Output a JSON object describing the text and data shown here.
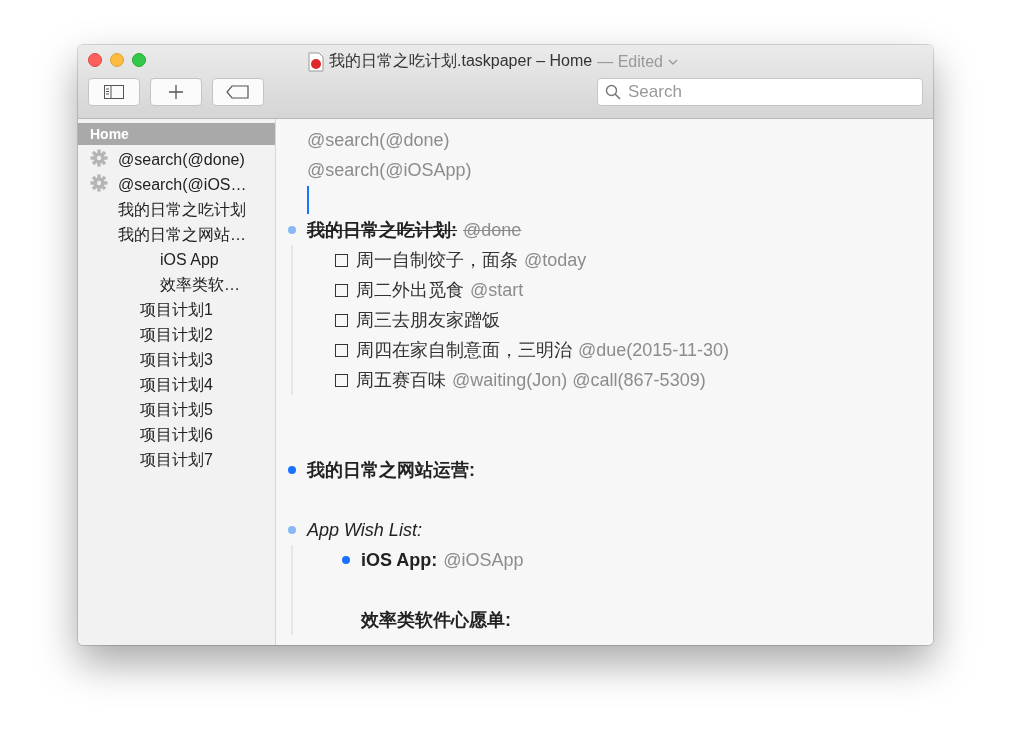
{
  "window": {
    "title": "我的日常之吃计划.taskpaper – Home",
    "status": "— Edited"
  },
  "toolbar": {
    "search": {
      "placeholder": "Search"
    }
  },
  "sidebar": {
    "items": [
      {
        "kind": "header",
        "label": "Home",
        "selected": true
      },
      {
        "kind": "search",
        "label": "@search(@done)",
        "selected": false
      },
      {
        "kind": "search",
        "label": "@search(@iOS…",
        "selected": false
      },
      {
        "kind": "project",
        "label": "我的日常之吃计划",
        "selected": false
      },
      {
        "kind": "project",
        "label": "我的日常之网站…",
        "selected": false,
        "children": [
          {
            "kind": "project",
            "label": "iOS App",
            "selected": false
          },
          {
            "kind": "project",
            "label": "效率类软…",
            "selected": false
          }
        ]
      },
      {
        "kind": "tag",
        "label": "项目计划1",
        "selected": false
      },
      {
        "kind": "tag",
        "label": "项目计划2",
        "selected": false
      },
      {
        "kind": "tag",
        "label": "项目计划3",
        "selected": false
      },
      {
        "kind": "tag",
        "label": "项目计划4",
        "selected": false
      },
      {
        "kind": "tag",
        "label": "项目计划5",
        "selected": false
      },
      {
        "kind": "tag",
        "label": "项目计划6",
        "selected": false
      },
      {
        "kind": "tag",
        "label": "项目计划7",
        "selected": false
      }
    ]
  },
  "editor": {
    "lines": [
      {
        "kind": "search",
        "text": "@search(@done)"
      },
      {
        "kind": "search",
        "text": "@search(@iOSApp)"
      },
      {
        "kind": "caret"
      },
      {
        "kind": "project",
        "text": "我的日常之吃计划:",
        "tags": "@done",
        "done": true,
        "collapsed": false,
        "children": [
          {
            "kind": "task",
            "text": "周一自制饺子，面条",
            "tags": "@today",
            "checked": false
          },
          {
            "kind": "task",
            "text": "周二外出觅食",
            "tags": "@start",
            "checked": false
          },
          {
            "kind": "task",
            "text": "周三去朋友家蹭饭",
            "checked": false
          },
          {
            "kind": "task",
            "text": "周四在家自制意面，三明治",
            "tags": "@due(2015-11-30)",
            "checked": false
          },
          {
            "kind": "task",
            "text": "周五赛百味",
            "tags": "@waiting(Jon) @call(867-5309)",
            "checked": false
          }
        ]
      },
      {
        "kind": "blank"
      },
      {
        "kind": "blank"
      },
      {
        "kind": "project",
        "text": "我的日常之网站运营:",
        "done": false,
        "collapsed": true
      },
      {
        "kind": "blank"
      },
      {
        "kind": "project",
        "text": "App Wish List:",
        "italic": true,
        "done": false,
        "collapsed": false,
        "children": [
          {
            "kind": "project",
            "text": "iOS App:",
            "tags": "@iOSApp",
            "done": false,
            "collapsed": true
          },
          {
            "kind": "blank"
          },
          {
            "kind": "project",
            "text": "效率类软件心愿单:",
            "done": false
          }
        ]
      }
    ]
  }
}
